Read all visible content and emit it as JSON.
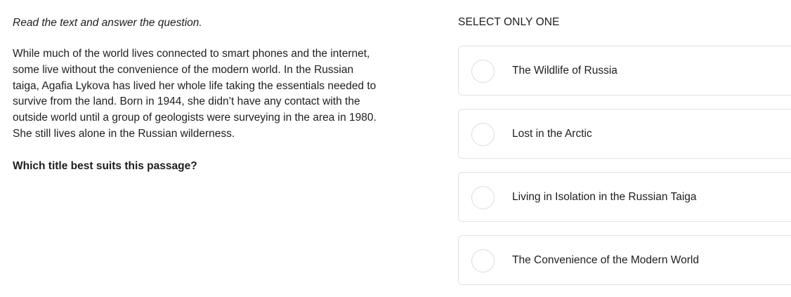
{
  "instruction": "Read the text and answer the question.",
  "passage": "While much of the world lives connected to smart phones and the internet, some live without the convenience of the modern world. In the Russian taiga, Agafia Lykova has lived her whole life taking the essentials needed to survive from the land. Born in 1944, she didn’t have any contact with the outside world until a group of geologists were surveying in the area in 1980. She still lives alone in the Russian wilderness.",
  "question": "Which title best suits this passage?",
  "select_label": "SELECT ONLY ONE",
  "options": [
    {
      "label": "The Wildlife of Russia"
    },
    {
      "label": "Lost in the Arctic"
    },
    {
      "label": "Living in Isolation in the Russian Taiga"
    },
    {
      "label": "The Convenience of the Modern World"
    }
  ]
}
